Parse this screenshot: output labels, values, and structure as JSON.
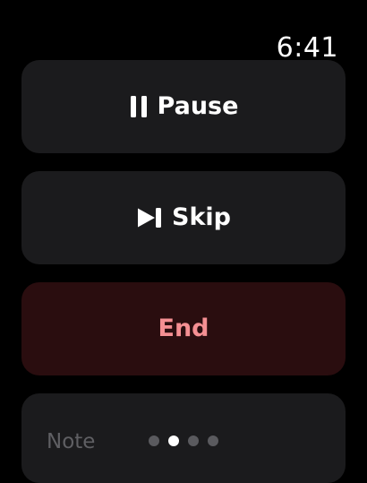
{
  "status_bar": {
    "time": "6:41"
  },
  "controls": {
    "pause": {
      "label": "Pause",
      "icon": "pause-icon"
    },
    "skip": {
      "label": "Skip",
      "icon": "skip-forward-icon"
    },
    "end": {
      "label": "End",
      "color": "#f58f93",
      "background": "#2a0d0f"
    }
  },
  "note": {
    "label": "Note"
  },
  "page_indicator": {
    "count": 4,
    "active_index": 1
  }
}
